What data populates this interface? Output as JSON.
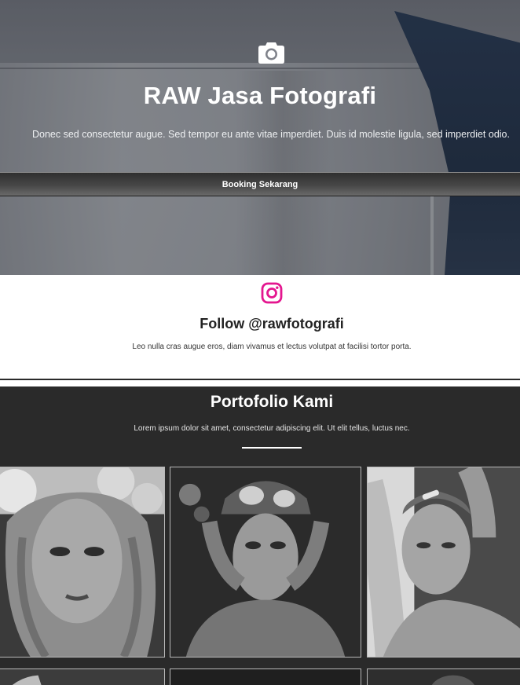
{
  "hero": {
    "icon": "camera-icon",
    "title": "RAW Jasa Fotografi",
    "subtitle": "Donec sed consectetur augue. Sed tempor eu ante vitae imperdiet. Duis id molestie ligula, sed imperdiet odio.",
    "booking_label": "Booking Sekarang"
  },
  "instagram": {
    "icon": "instagram-icon",
    "icon_color": "#e4168f",
    "title": "Follow @rawfotografi",
    "subtitle": "Leo nulla cras augue eros, diam vivamus et lectus volutpat at facilisi tortor porta."
  },
  "portfolio": {
    "title": "Portofolio Kami",
    "subtitle": "Lorem ipsum dolor sit amet, consectetur adipiscing elit. Ut elit tellus, luctus nec.",
    "background": "#2a2a2a",
    "photos": [
      {
        "name": "portrait-flower-crown"
      },
      {
        "name": "portrait-beanie-okay"
      },
      {
        "name": "portrait-arm-raised"
      },
      {
        "name": "portrait-row2-1"
      },
      {
        "name": "portrait-row2-2"
      },
      {
        "name": "portrait-row2-3"
      }
    ]
  }
}
